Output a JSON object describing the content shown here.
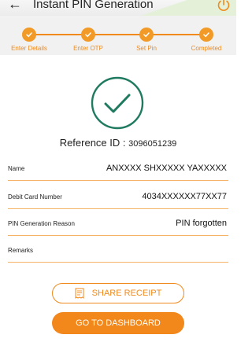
{
  "header": {
    "title": "Instant PIN Generation",
    "back_icon": "back-arrow-icon",
    "power_icon": "power-icon"
  },
  "stepper": {
    "steps": [
      {
        "label": "Enter Details",
        "status": "completed"
      },
      {
        "label": "Enter OTP",
        "status": "completed"
      },
      {
        "label": "Set Pin",
        "status": "completed"
      },
      {
        "label": "Completed",
        "status": "completed"
      }
    ]
  },
  "result": {
    "icon": "check-circle-icon",
    "reference_label": "Reference ID : ",
    "reference_value": "3096051239"
  },
  "details": [
    {
      "label": "Name",
      "value": "ANXXXX SHXXXXX YAXXXXX"
    },
    {
      "label": "Debit Card Number",
      "value": "4034XXXXXX77XX77"
    },
    {
      "label": "PIN Generation Reason",
      "value": "PIN forgotten"
    },
    {
      "label": "Remarks",
      "value": ""
    }
  ],
  "actions": {
    "share_receipt": "SHARE RECEIPT",
    "go_to_dashboard": "GO TO DASHBOARD"
  },
  "colors": {
    "accent": "#f08a1c",
    "success": "#1f7a60"
  }
}
